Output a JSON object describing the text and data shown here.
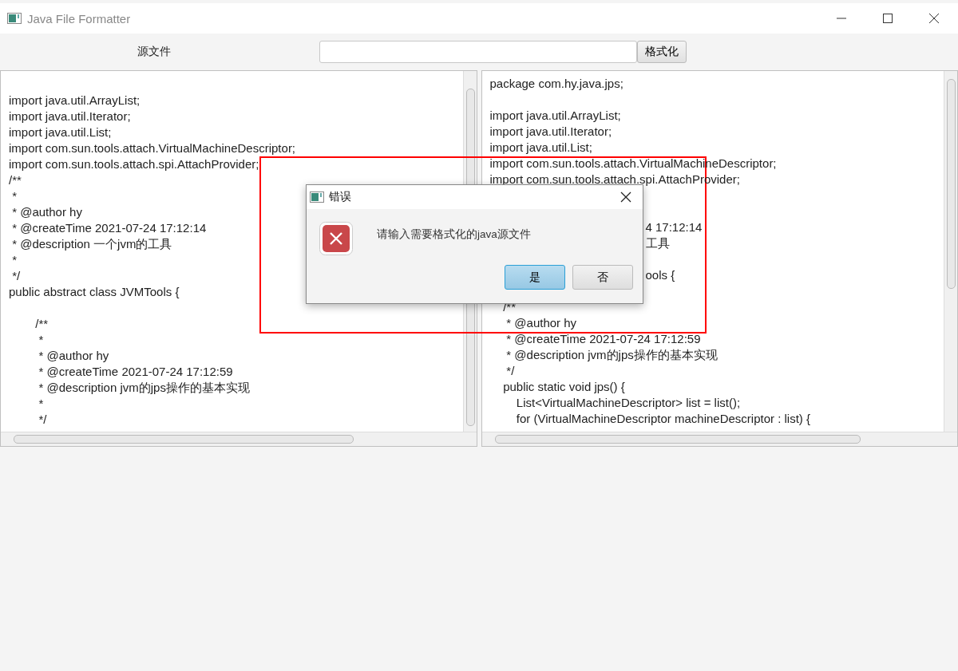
{
  "window": {
    "title": "Java File Formatter"
  },
  "toolbar": {
    "label": "源文件",
    "button": "格式化"
  },
  "source_pane": {
    "lines": [
      {
        "kind": "blank"
      },
      {
        "kind": "code",
        "text": "import java.util.ArrayList;"
      },
      {
        "kind": "code",
        "text": "import java.util.Iterator;"
      },
      {
        "kind": "code",
        "text": "import java.util.List;"
      },
      {
        "kind": "code",
        "text": "import com.sun.tools.attach.VirtualMachineDescriptor;"
      },
      {
        "kind": "code",
        "text": "import com.sun.tools.attach.spi.AttachProvider;"
      },
      {
        "kind": "code",
        "text": "/**"
      },
      {
        "kind": "code",
        "text": " *"
      },
      {
        "kind": "code",
        "text": " * @author hy"
      },
      {
        "kind": "code",
        "text": " * @createTime 2021-07-24 17:12:14"
      },
      {
        "kind": "code",
        "text": " * @description 一个jvm的工具"
      },
      {
        "kind": "code",
        "text": " *"
      },
      {
        "kind": "code",
        "text": " */"
      },
      {
        "kind": "code",
        "text": "public abstract class JVMTools {"
      },
      {
        "kind": "blank"
      },
      {
        "kind": "code",
        "text": "\t/**"
      },
      {
        "kind": "code",
        "text": "\t *"
      },
      {
        "kind": "code",
        "text": "\t * @author hy"
      },
      {
        "kind": "code",
        "text": "\t * @createTime 2021-07-24 17:12:59"
      },
      {
        "kind": "code",
        "text": "\t * @description jvm的jps操作的基本实现"
      },
      {
        "kind": "code",
        "text": "\t *"
      },
      {
        "kind": "code",
        "text": "\t */"
      }
    ]
  },
  "result_pane": {
    "lines": [
      {
        "kind": "code",
        "text": "package com.hy.java.jps;"
      },
      {
        "kind": "blank"
      },
      {
        "kind": "code",
        "text": "import java.util.ArrayList;"
      },
      {
        "kind": "code",
        "text": "import java.util.Iterator;"
      },
      {
        "kind": "code",
        "text": "import java.util.List;"
      },
      {
        "kind": "code",
        "text": "import com.sun.tools.attach.VirtualMachineDescriptor;"
      },
      {
        "kind": "code",
        "text": "import com.sun.tools.attach.spi.AttachProvider;"
      },
      {
        "kind": "covered"
      },
      {
        "kind": "covered"
      },
      {
        "kind": "clipped",
        "text": "4 17:12:14"
      },
      {
        "kind": "clipped",
        "text": "工具"
      },
      {
        "kind": "covered"
      },
      {
        "kind": "clipped",
        "text": "ools {"
      },
      {
        "kind": "blank"
      },
      {
        "kind": "code",
        "text": "    /**"
      },
      {
        "kind": "code",
        "text": "     * @author hy"
      },
      {
        "kind": "code",
        "text": "     * @createTime 2021-07-24 17:12:59"
      },
      {
        "kind": "code",
        "text": "     * @description jvm的jps操作的基本实现"
      },
      {
        "kind": "code",
        "text": "     */"
      },
      {
        "kind": "code",
        "text": "    public static void jps() {"
      },
      {
        "kind": "code",
        "text": "        List<VirtualMachineDescriptor> list = list();"
      },
      {
        "kind": "code",
        "text": "        for (VirtualMachineDescriptor machineDescriptor : list) {"
      }
    ]
  },
  "dialog": {
    "title": "错误",
    "message": "请输入需要格式化的java源文件",
    "buttons": [
      {
        "label": "是",
        "selected": true
      },
      {
        "label": "否",
        "selected": false
      }
    ]
  },
  "annotation": {
    "kind": "highlight"
  }
}
